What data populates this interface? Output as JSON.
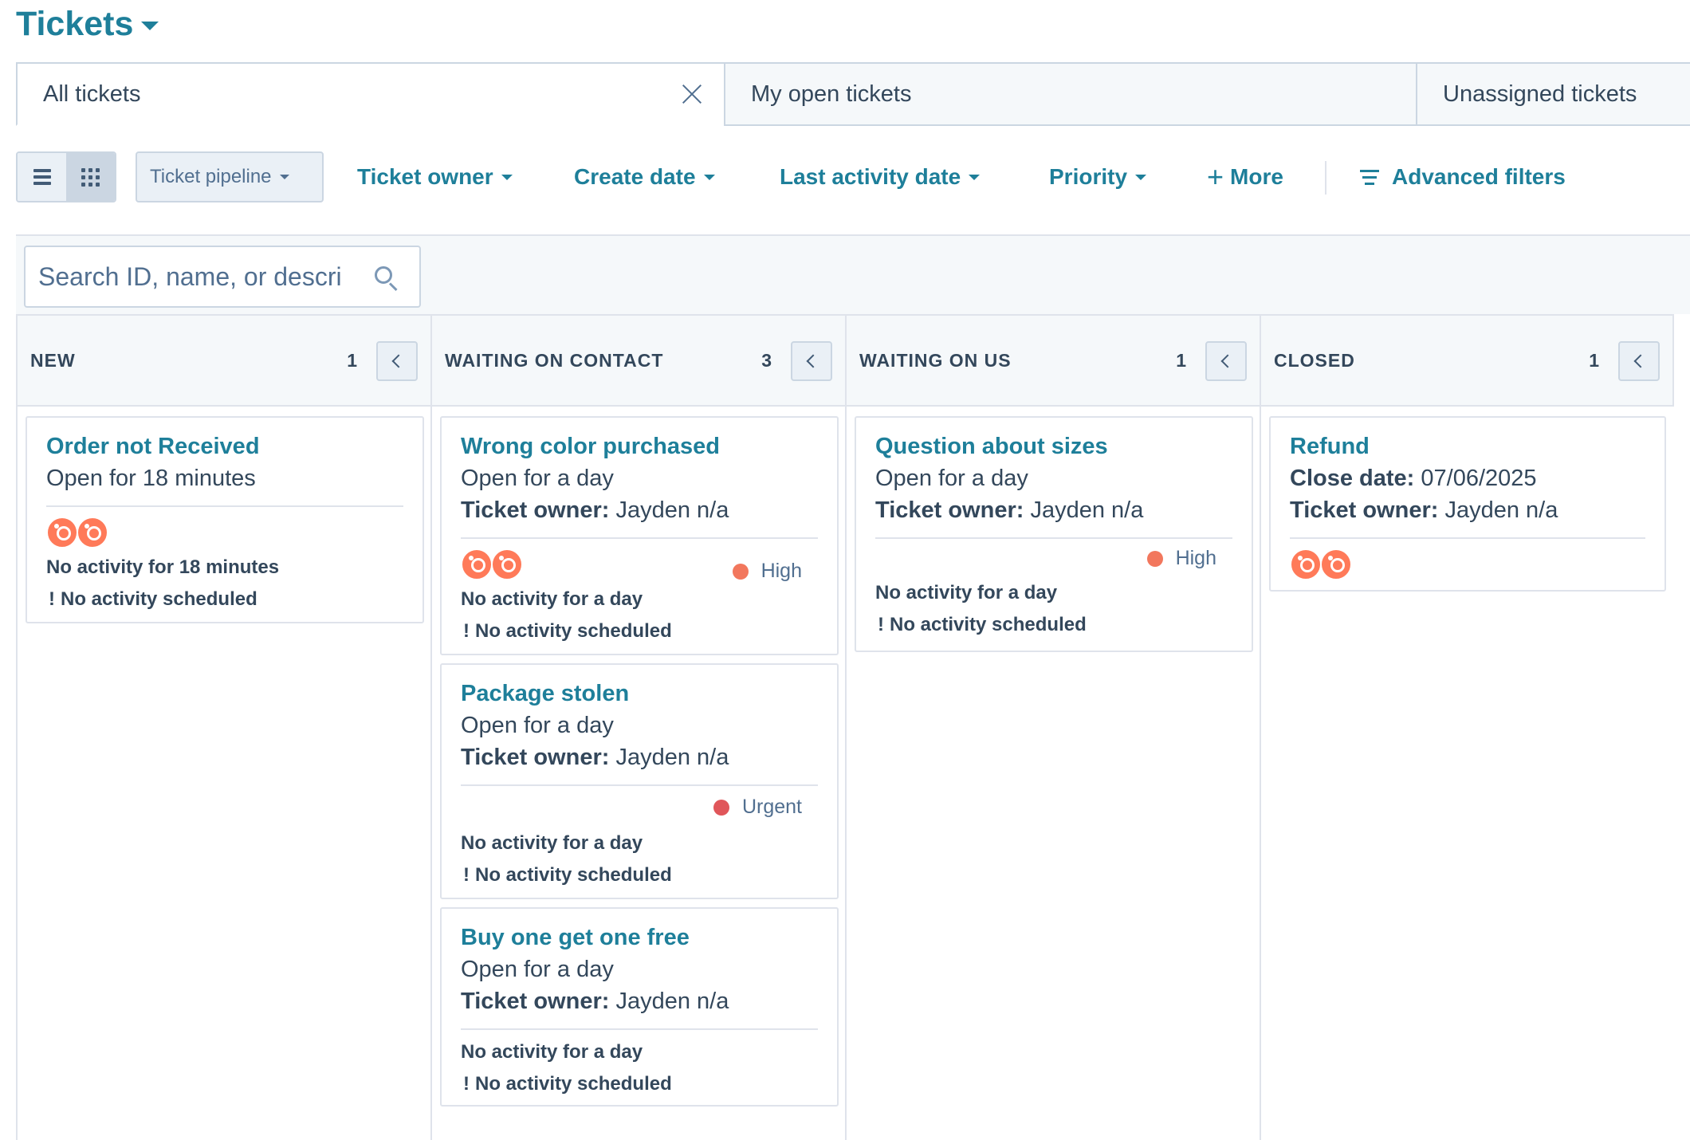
{
  "page": {
    "title": "Tickets"
  },
  "tabs": [
    {
      "label": "All tickets"
    },
    {
      "label": "My open tickets"
    },
    {
      "label": "Unassigned tickets"
    }
  ],
  "toolbar": {
    "pipeline_label": "Ticket pipeline",
    "filters": {
      "ticket_owner": "Ticket owner",
      "create_date": "Create date",
      "last_activity_date": "Last activity date",
      "priority": "Priority",
      "more": "More",
      "advanced": "Advanced filters"
    }
  },
  "search": {
    "placeholder": "Search ID, name, or descri"
  },
  "colors": {
    "accent": "#1e7f9a",
    "avatar": "#ff7a59",
    "priority_high": "#f2775d",
    "priority_urgent": "#e0565a"
  },
  "columns": [
    {
      "name": "NEW",
      "count": "1",
      "cards": [
        {
          "title": "Order not Received",
          "line1": "Open for 18 minutes",
          "activity": "No activity for 18 minutes",
          "scheduled": "No activity scheduled"
        }
      ]
    },
    {
      "name": "WAITING ON CONTACT",
      "count": "3",
      "cards": [
        {
          "title": "Wrong color purchased",
          "line1": "Open for a day",
          "owner_label": "Ticket owner:",
          "owner": " Jayden n/a",
          "priority": "High",
          "activity": "No activity for a day",
          "scheduled": "No activity scheduled"
        },
        {
          "title": "Package stolen",
          "line1": "Open for a day",
          "owner_label": "Ticket owner:",
          "owner": " Jayden n/a",
          "priority": "Urgent",
          "activity": "No activity for a day",
          "scheduled": "No activity scheduled"
        },
        {
          "title": "Buy one get one free",
          "line1": "Open for a day",
          "owner_label": "Ticket owner:",
          "owner": " Jayden n/a",
          "activity": "No activity for a day",
          "scheduled": "No activity scheduled"
        }
      ]
    },
    {
      "name": "WAITING ON US",
      "count": "1",
      "cards": [
        {
          "title": "Question about sizes",
          "line1": "Open for a day",
          "owner_label": "Ticket owner:",
          "owner": " Jayden n/a",
          "priority": "High",
          "activity": "No activity for a day",
          "scheduled": "No activity scheduled"
        }
      ]
    },
    {
      "name": "CLOSED",
      "count": "1",
      "cards": [
        {
          "title": "Refund",
          "close_label": "Close date:",
          "close_date": " 07/06/2025",
          "owner_label": "Ticket owner:",
          "owner": " Jayden n/a"
        }
      ]
    }
  ]
}
